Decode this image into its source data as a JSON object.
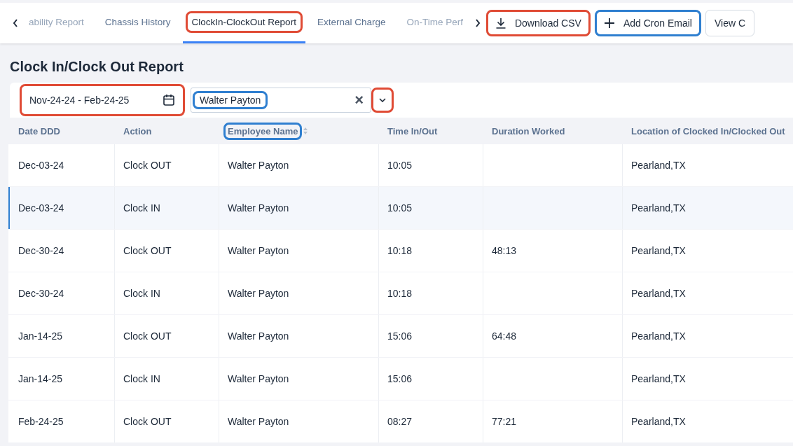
{
  "tabs": [
    {
      "label": "ability Report",
      "selected": false,
      "faded": true
    },
    {
      "label": "Chassis History",
      "selected": false,
      "faded": false
    },
    {
      "label": "ClockIn-ClockOut Report",
      "selected": true,
      "faded": false,
      "color": "#e04b35"
    },
    {
      "label": "External Charge",
      "selected": false,
      "faded": false
    },
    {
      "label": "On-Time Perf",
      "selected": false,
      "faded": true
    }
  ],
  "actions": [
    {
      "kind": "download",
      "label": "Download CSV",
      "color": "#e04b35"
    },
    {
      "kind": "add",
      "label": "Add Cron Email",
      "color": "#2f7fd0"
    },
    {
      "kind": "plain",
      "label": "View C"
    }
  ],
  "title": "Clock In/Clock Out Report",
  "filters": {
    "date_range": {
      "value": "Nov-24-24 - Feb-24-25",
      "color": "#e04b35"
    },
    "employee": {
      "value": "Walter Payton",
      "color": "#2f7fd0",
      "clear": "×",
      "dropdown": {
        "color": "#e04b35"
      }
    }
  },
  "table": {
    "columns": [
      {
        "label": "Date DDD",
        "sortable": false
      },
      {
        "label": "Action",
        "sortable": false
      },
      {
        "label": "Employee Name",
        "sortable": true,
        "color": "#2f7fd0"
      },
      {
        "label": "Time In/Out",
        "sortable": false
      },
      {
        "label": "Duration Worked",
        "sortable": false
      },
      {
        "label": "Location of Clocked In/Clocked Out",
        "sortable": false
      }
    ],
    "rows": [
      {
        "selected": false,
        "cells": [
          "Dec-03-24",
          "Clock OUT",
          "Walter Payton",
          "10:05",
          "",
          "Pearland,TX"
        ]
      },
      {
        "selected": true,
        "cells": [
          "Dec-03-24",
          "Clock IN",
          "Walter Payton",
          "10:05",
          "",
          "Pearland,TX"
        ]
      },
      {
        "selected": false,
        "cells": [
          "Dec-30-24",
          "Clock OUT",
          "Walter Payton",
          "10:18",
          "48:13",
          "Pearland,TX"
        ]
      },
      {
        "selected": false,
        "cells": [
          "Dec-30-24",
          "Clock IN",
          "Walter Payton",
          "10:18",
          "",
          "Pearland,TX"
        ]
      },
      {
        "selected": false,
        "cells": [
          "Jan-14-25",
          "Clock OUT",
          "Walter Payton",
          "15:06",
          "64:48",
          "Pearland,TX"
        ]
      },
      {
        "selected": false,
        "cells": [
          "Jan-14-25",
          "Clock IN",
          "Walter Payton",
          "15:06",
          "",
          "Pearland,TX"
        ]
      },
      {
        "selected": false,
        "cells": [
          "Feb-24-25",
          "Clock OUT",
          "Walter Payton",
          "08:27",
          "77:21",
          "Pearland,TX"
        ]
      }
    ]
  }
}
